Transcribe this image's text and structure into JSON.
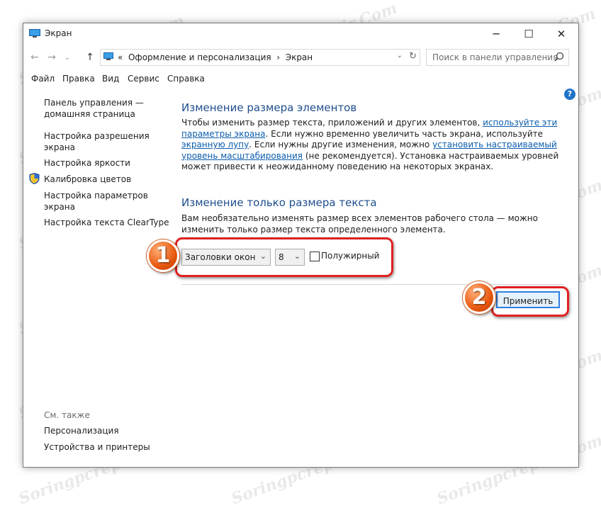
{
  "window": {
    "title": "Экран"
  },
  "address": {
    "prefix": "«",
    "crumb1": "Оформление и персонализация",
    "sep": "›",
    "crumb2": "Экран",
    "search_placeholder": "Поиск в панели управления"
  },
  "menu": [
    "Файл",
    "Правка",
    "Вид",
    "Сервис",
    "Справка"
  ],
  "sidebar": {
    "home_line1": "Панель управления —",
    "home_line2": "домашняя страница",
    "resolution_line1": "Настройка разрешения",
    "resolution_line2": "экрана",
    "brightness": "Настройка яркости",
    "calibration": "Калибровка цветов",
    "params_line1": "Настройка параметров",
    "params_line2": "экрана",
    "cleartype": "Настройка текста ClearType",
    "see_also": "См. также",
    "personalization": "Персонализация",
    "devices": "Устройства и принтеры"
  },
  "main": {
    "heading1": "Изменение размера элементов",
    "p1_a": "Чтобы изменить размер текста, приложений и других элементов, ",
    "p1_link1": "используйте эти параметры экрана",
    "p1_b": ". Если нужно временно увеличить часть экрана, используйте ",
    "p1_link2": "экранную лупу",
    "p1_c": ". Если нужны другие изменения, можно ",
    "p1_link3": "установить настраиваемый уровень масштабирования",
    "p1_d": " (не рекомендуется). Установка настраиваемых уровней может привести к неожиданному поведению на некоторых экранах.",
    "heading2": "Изменение только размера текста",
    "p2": "Вам необязательно изменять размер всех элементов рабочего стола — можно изменить только размер текста определенного элемента.",
    "element_select": "Заголовки окон",
    "size_select": "8",
    "bold_label": "Полужирный",
    "bold_checked": false,
    "apply_button": "Применить"
  },
  "annotations": {
    "badge1": "1",
    "badge2": "2"
  },
  "watermark": "Soringpcrepair.Com",
  "colors": {
    "heading": "#1e4e8c",
    "link": "#0b5cad",
    "highlight": "#e02020",
    "badge": "#e8580e"
  }
}
